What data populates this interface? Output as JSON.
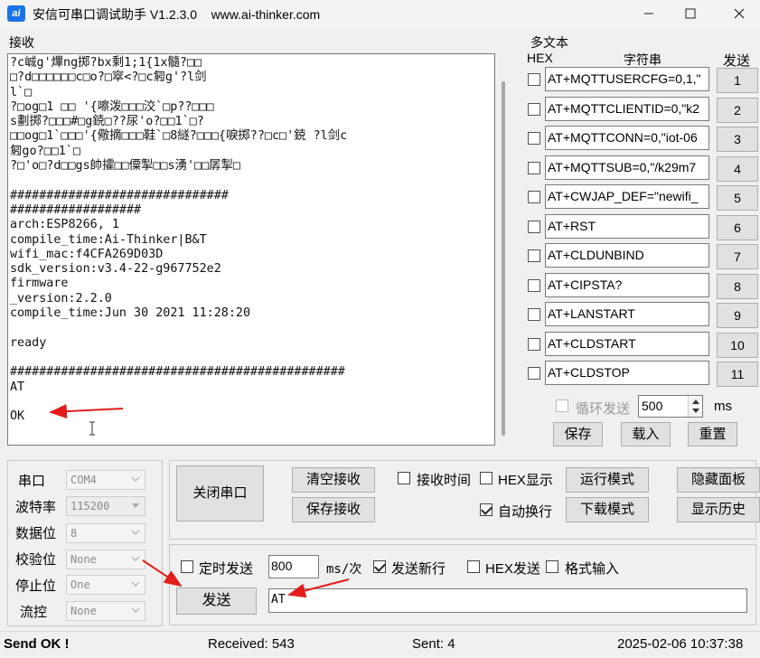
{
  "window": {
    "title": "安信可串口调试助手 V1.2.3.0    www.ai-thinker.com",
    "icon_text": "ai"
  },
  "receive": {
    "label": "接收",
    "lines": [
      "?c峸g'熚ng掷?bx剩1;1{1x髓?□□",
      "□?d□□□□□□c□o?□窣<?□c匑g'?l剑",
      "l`□",
      "?□og□1 □□ '{嚓泼□□□洨`□p??□□□",
      "s劃掷?□□□#□g鋴□??尿'o?□□1`□?",
      "□□og□1`□□□'{儆摘□□□鞋`□8繸?□□□{唳掷??□c□'鋴 ?l剑c",
      "匑go?□□1`□",
      "?□'o□?d□□gs帥攉□□僳掣□□s湧'□□孱掣□",
      "",
      "##############################",
      "##################",
      "arch:ESP8266, 1",
      "compile_time:Ai-Thinker|B&T",
      "wifi_mac:f4CFA269D03D",
      "sdk_version:v3.4-22-g967752e2",
      "firmware",
      "_version:2.2.0",
      "compile_time:Jun 30 2021 11:28:20",
      "",
      "ready",
      "",
      "##############################################",
      "AT",
      "",
      "OK"
    ]
  },
  "multi": {
    "label": "多文本",
    "hex_header": "HEX",
    "string_header": "字符串",
    "send_header": "发送",
    "rows": [
      {
        "text": "AT+MQTTUSERCFG=0,1,\"",
        "btn": "1"
      },
      {
        "text": "AT+MQTTCLIENTID=0,\"k2",
        "btn": "2"
      },
      {
        "text": "AT+MQTTCONN=0,\"iot-06",
        "btn": "3"
      },
      {
        "text": "AT+MQTTSUB=0,\"/k29m7",
        "btn": "4"
      },
      {
        "text": "AT+CWJAP_DEF=\"newifi_",
        "btn": "5"
      },
      {
        "text": "AT+RST",
        "btn": "6"
      },
      {
        "text": "AT+CLDUNBIND",
        "btn": "7"
      },
      {
        "text": "AT+CIPSTA?",
        "btn": "8"
      },
      {
        "text": "AT+LANSTART",
        "btn": "9"
      },
      {
        "text": "AT+CLDSTART",
        "btn": "10"
      },
      {
        "text": "AT+CLDSTOP",
        "btn": "11"
      }
    ],
    "loop_label": "循环发送",
    "loop_value": "500",
    "ms_label": "ms",
    "save_label": "保存",
    "load_label": "载入",
    "reset_label": "重置"
  },
  "settings": {
    "port_label": "串口",
    "port_value": "COM4",
    "baud_label": "波特率",
    "baud_value": "115200",
    "databits_label": "数据位",
    "databits_value": "8",
    "parity_label": "校验位",
    "parity_value": "None",
    "stopbits_label": "停止位",
    "stopbits_value": "One",
    "flow_label": "流控",
    "flow_value": "None"
  },
  "controls": {
    "close_port": "关闭串口",
    "clear_recv": "清空接收",
    "save_recv": "保存接收",
    "recv_time": "接收时间",
    "hex_display": "HEX显示",
    "run_mode": "运行模式",
    "hide_panel": "隐藏面板",
    "auto_wrap": "自动换行",
    "download_mode": "下载模式",
    "show_history": "显示历史",
    "timed_send": "定时发送",
    "timed_value": "800",
    "ms_per": "ms/次",
    "send_newline": "发送新行",
    "hex_send": "HEX发送",
    "format_input": "格式输入",
    "send_button": "发送",
    "send_text": "AT"
  },
  "status": {
    "message": "Send OK !",
    "received": "Received: 543",
    "sent": "Sent: 4",
    "datetime": "2025-02-06 10:37:38"
  }
}
